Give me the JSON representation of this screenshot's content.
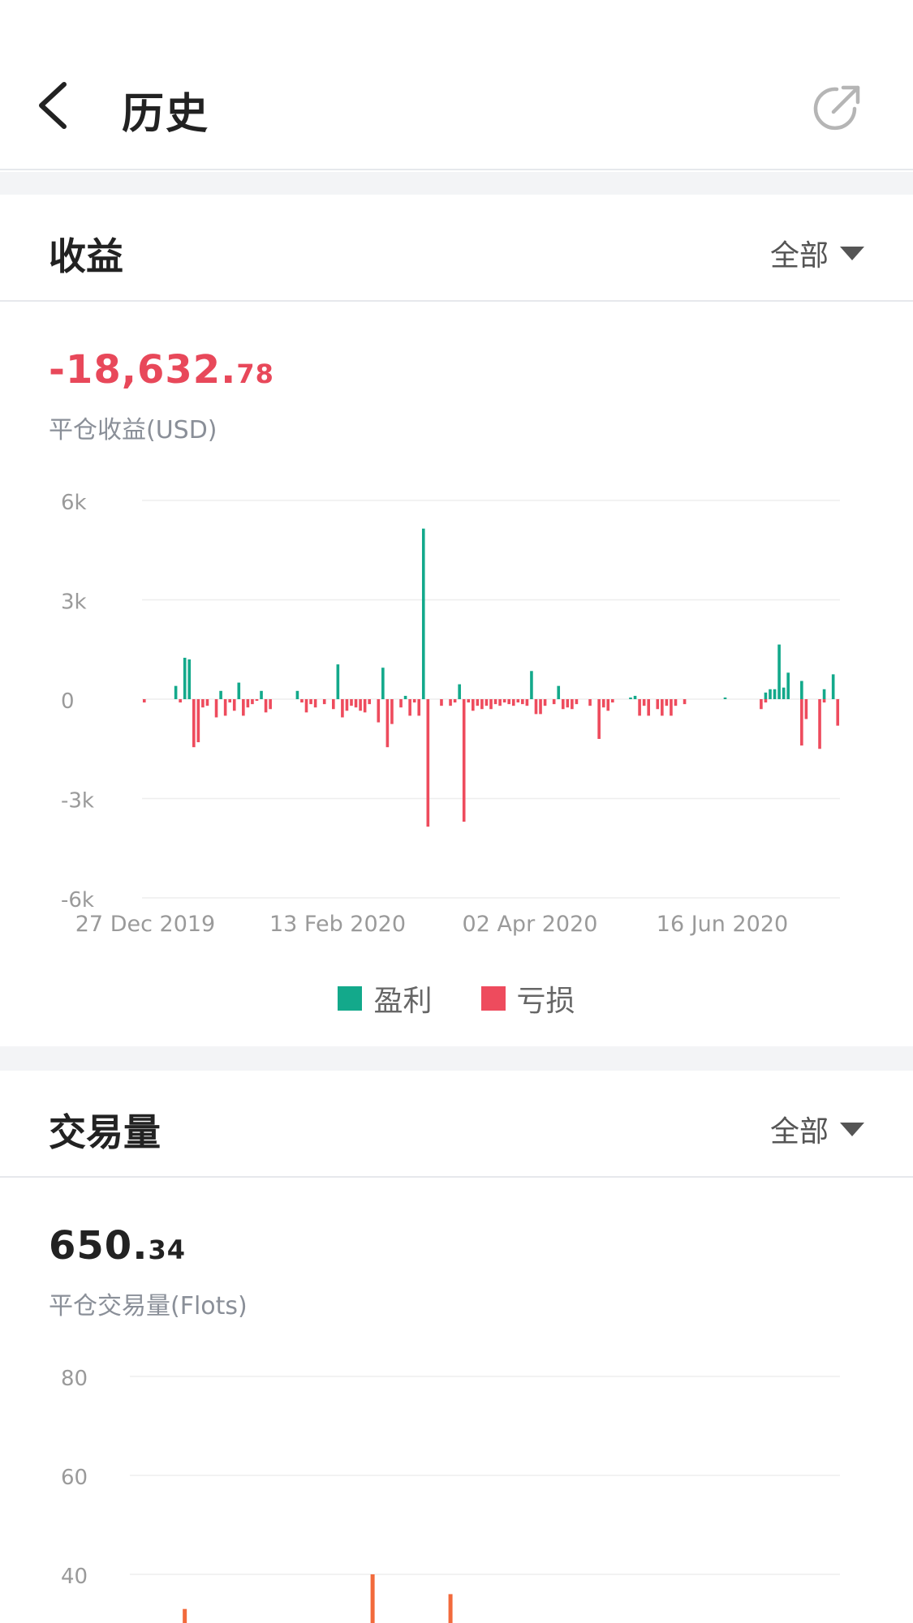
{
  "header": {
    "title": "历史",
    "back_icon": "chevron-left-icon",
    "share_icon": "share-icon"
  },
  "profit_section": {
    "title": "收益",
    "filter_label": "全部",
    "value_main": "-18,632.",
    "value_decimal": "78",
    "value_color": "#e8485a",
    "sub_label": "平仓收益(USD)",
    "legend": [
      {
        "label": "盈利",
        "color": "#13a98b"
      },
      {
        "label": "亏损",
        "color": "#ee4b5d"
      }
    ]
  },
  "volume_section": {
    "title": "交易量",
    "filter_label": "全部",
    "value_main": "650.",
    "value_decimal": "34",
    "sub_label": "平仓交易量(Flots)"
  },
  "chart_data": [
    {
      "type": "bar",
      "ylim": [
        -6000,
        6000
      ],
      "yticks": [
        6000,
        3000,
        0,
        -3000,
        -6000
      ],
      "ytick_labels": [
        "6k",
        "3k",
        "0",
        "-3k",
        "-6k"
      ],
      "xtick_labels": [
        "27 Dec 2019",
        "13 Feb 2020",
        "02 Apr 2020",
        "16 Jun 2020"
      ],
      "colors": {
        "positive": "#13a98b",
        "negative": "#ee4b5d"
      },
      "series": [
        {
          "name": "盈利",
          "values": [
            0,
            0,
            0,
            0,
            0,
            0,
            0,
            400,
            0,
            1250,
            1200,
            0,
            0,
            0,
            0,
            0,
            0,
            250,
            0,
            0,
            0,
            500,
            0,
            0,
            0,
            0,
            250,
            0,
            0,
            0,
            0,
            0,
            0,
            0,
            250,
            0,
            0,
            0,
            0,
            0,
            0,
            0,
            0,
            1050,
            0,
            0,
            0,
            0,
            0,
            0,
            0,
            0,
            0,
            950,
            0,
            0,
            0,
            0,
            100,
            0,
            0,
            0,
            5150,
            0,
            0,
            0,
            0,
            0,
            0,
            0,
            450,
            0,
            0,
            0,
            0,
            0,
            0,
            0,
            0,
            0,
            0,
            0,
            0,
            0,
            0,
            0,
            850,
            0,
            0,
            0,
            0,
            0,
            400,
            0,
            0,
            0,
            0,
            0,
            0,
            0,
            0,
            0,
            0,
            0,
            0,
            0,
            0,
            0,
            50,
            100,
            0,
            0,
            0,
            0,
            0,
            0,
            0,
            0,
            0,
            0,
            0,
            0,
            0,
            0,
            0,
            0,
            0,
            0,
            0,
            50,
            0,
            0,
            0,
            0,
            0,
            0,
            0,
            0,
            200,
            300,
            300,
            1650,
            350,
            800,
            0,
            0,
            550,
            0,
            0,
            0,
            0,
            300,
            0,
            750,
            0
          ]
        },
        {
          "name": "亏损",
          "values": [
            -100,
            0,
            0,
            0,
            0,
            0,
            0,
            0,
            -100,
            0,
            0,
            -1450,
            -1300,
            -250,
            -200,
            0,
            -550,
            0,
            -500,
            -100,
            -350,
            0,
            -500,
            -250,
            -150,
            -50,
            0,
            -400,
            -300,
            0,
            0,
            0,
            0,
            0,
            0,
            -100,
            -400,
            -150,
            -250,
            0,
            -150,
            0,
            -300,
            0,
            -550,
            -350,
            -200,
            -250,
            -350,
            -400,
            -150,
            0,
            -700,
            0,
            -1450,
            -750,
            0,
            -250,
            0,
            -500,
            -100,
            -500,
            0,
            -3850,
            0,
            0,
            -200,
            0,
            -200,
            -100,
            0,
            -3700,
            -100,
            -350,
            -200,
            -300,
            -200,
            -300,
            -150,
            -200,
            -100,
            -150,
            -200,
            -100,
            -150,
            -200,
            0,
            -450,
            -450,
            -200,
            0,
            -150,
            0,
            -300,
            -250,
            -300,
            -150,
            0,
            0,
            -200,
            0,
            -1200,
            -250,
            -350,
            -100,
            0,
            0,
            0,
            0,
            0,
            -500,
            -200,
            -500,
            0,
            -300,
            -500,
            -200,
            -500,
            -200,
            0,
            -150,
            0,
            0,
            0,
            0,
            0,
            0,
            0,
            0,
            0,
            0,
            0,
            0,
            0,
            0,
            0,
            0,
            -300,
            -100,
            0,
            0,
            0,
            0,
            0,
            0,
            0,
            -1400,
            -600,
            0,
            0,
            -1500,
            -100,
            0,
            0,
            -800
          ]
        }
      ]
    },
    {
      "type": "bar",
      "yticks": [
        80,
        60,
        40
      ],
      "ytick_labels": [
        "80",
        "60",
        "40"
      ],
      "ylim": [
        0,
        80
      ],
      "colors": {
        "bar": "#f26a3c"
      },
      "visible_bars": [
        {
          "index": 8,
          "value": 33
        },
        {
          "index": 49,
          "value": 40
        },
        {
          "index": 66,
          "value": 36
        }
      ]
    }
  ]
}
